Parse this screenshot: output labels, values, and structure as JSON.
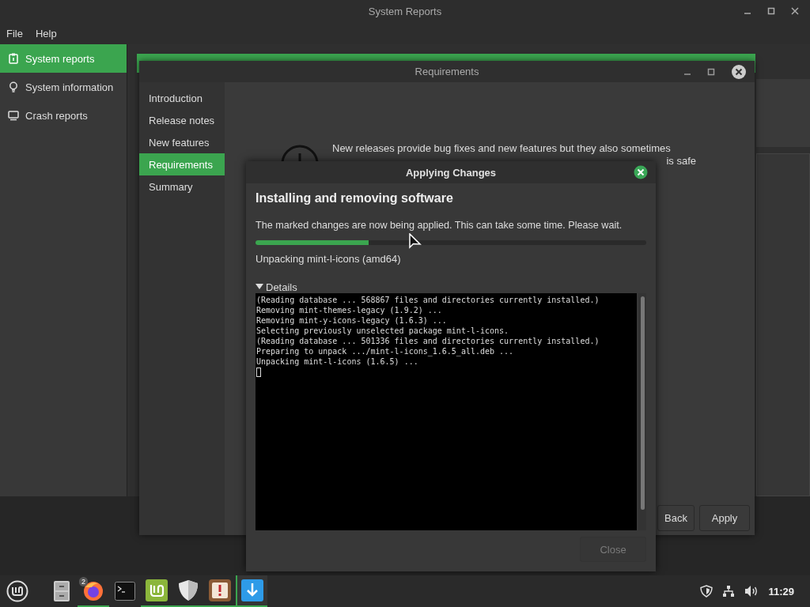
{
  "main_window": {
    "title": "System Reports",
    "menu": [
      "File",
      "Help"
    ],
    "sidebar": [
      {
        "label": "System reports",
        "selected": true
      },
      {
        "label": "System information",
        "selected": false
      },
      {
        "label": "Crash reports",
        "selected": false
      }
    ]
  },
  "requirements_window": {
    "title": "Requirements",
    "steps": [
      {
        "label": "Introduction",
        "selected": false
      },
      {
        "label": "Release notes",
        "selected": false
      },
      {
        "label": "New features",
        "selected": false
      },
      {
        "label": "Requirements",
        "selected": true
      },
      {
        "label": "Summary",
        "selected": false
      }
    ],
    "message_line_1": "New releases provide bug fixes and new features but they also sometimes",
    "message_line_2_end": "is safe",
    "buttons": [
      "Back",
      "Apply"
    ]
  },
  "dialog": {
    "title": "Applying Changes",
    "heading": "Installing and removing software",
    "description": "The marked changes are now being applied. This can take some time. Please wait.",
    "progress": {
      "level": 0.29
    },
    "status": "Unpacking mint-l-icons (amd64)",
    "details": {
      "label": "Details",
      "expanded": true,
      "lines": [
        "(Reading database ... 568867 files and directories currently installed.)",
        "Removing mint-themes-legacy (1.9.2) ...",
        "Removing mint-y-icons-legacy (1.6.3) ...",
        "Selecting previously unselected package mint-l-icons.",
        "(Reading database ... 501336 files and directories currently installed.)",
        "Preparing to unpack .../mint-l-icons_1.6.5_all.deb ...",
        "Unpacking mint-l-icons (1.6.5) ..."
      ]
    },
    "close_button": {
      "label": "Close",
      "disabled": true
    }
  },
  "taskbar": {
    "apps": [
      {
        "kind": "menu",
        "running": false,
        "selected": false
      },
      {
        "kind": "files",
        "running": false,
        "selected": false
      },
      {
        "kind": "browser",
        "running": true,
        "selected": false,
        "badge": "2"
      },
      {
        "kind": "terminal",
        "running": false,
        "selected": false
      },
      {
        "kind": "mint",
        "running": true,
        "selected": false
      },
      {
        "kind": "shield",
        "running": true,
        "selected": false
      },
      {
        "kind": "alert",
        "running": true,
        "selected": false
      },
      {
        "kind": "download",
        "running": true,
        "selected": true
      }
    ],
    "clock": "11:29"
  }
}
